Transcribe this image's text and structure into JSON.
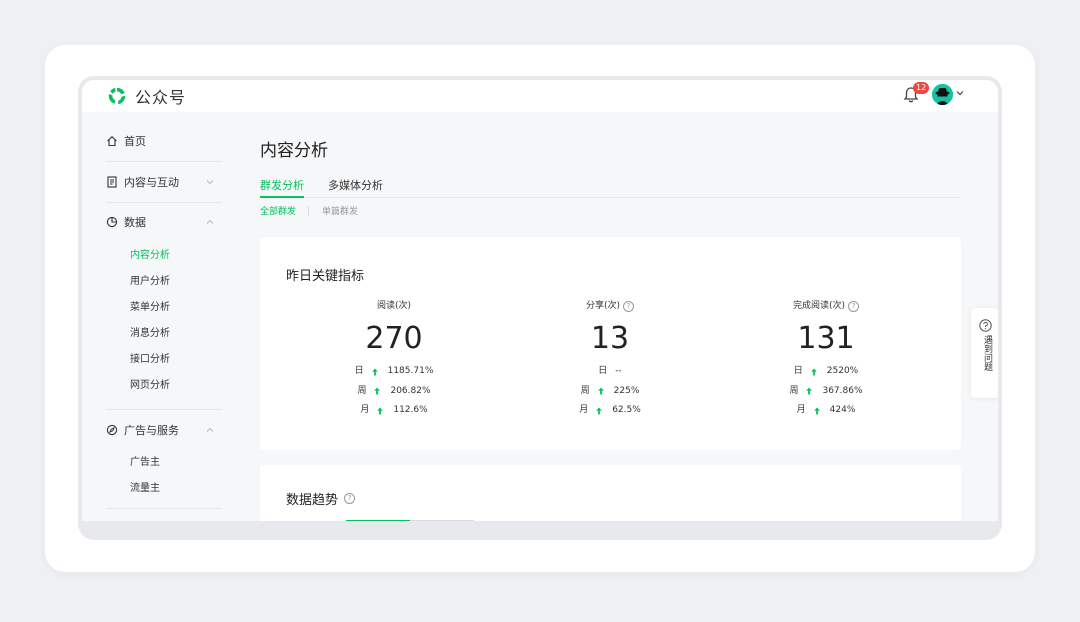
{
  "header": {
    "app_name": "公众号",
    "notification_count": "12",
    "brand_color": "#07c160"
  },
  "sidebar": {
    "home": "首页",
    "content": "内容与互动",
    "data": "数据",
    "data_items": [
      "内容分析",
      "用户分析",
      "菜单分析",
      "消息分析",
      "接口分析",
      "网页分析"
    ],
    "ads": "广告与服务",
    "ads_items": [
      "广告主",
      "流量主"
    ]
  },
  "main": {
    "title": "内容分析",
    "tabs": [
      "群发分析",
      "多媒体分析"
    ],
    "subtabs": [
      "全部群发",
      "单篇群发"
    ],
    "key_metrics": {
      "title": "昨日关键指标",
      "metrics": [
        {
          "label": "阅读(次)",
          "value": "270",
          "rows": [
            {
              "label": "日",
              "value": "1185.71%"
            },
            {
              "label": "周",
              "value": "206.82%"
            },
            {
              "label": "月",
              "value": "112.6%"
            }
          ]
        },
        {
          "label": "分享(次)",
          "value": "13",
          "rows": [
            {
              "label": "日",
              "value": "--"
            },
            {
              "label": "周",
              "value": "225%"
            },
            {
              "label": "月",
              "value": "62.5%"
            }
          ]
        },
        {
          "label": "完成阅读(次)",
          "value": "131",
          "rows": [
            {
              "label": "日",
              "value": "2520%"
            },
            {
              "label": "周",
              "value": "367.86%"
            },
            {
              "label": "月",
              "value": "424%"
            }
          ]
        }
      ]
    },
    "trend": {
      "title": "数据趋势"
    }
  },
  "help_float": {
    "label": "遇到问题"
  }
}
